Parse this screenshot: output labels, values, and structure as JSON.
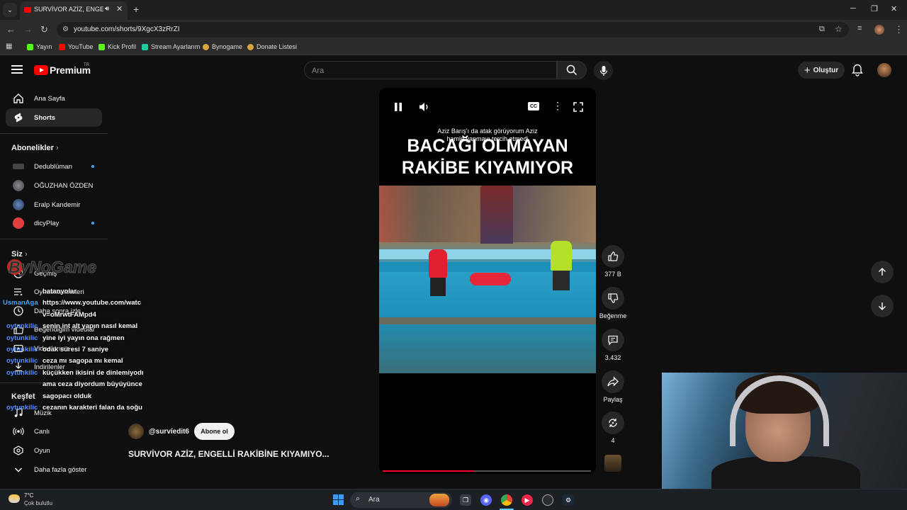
{
  "browser": {
    "tab_title": "SURVİVOR AZİZ, ENGELLİ R",
    "url": "youtube.com/shorts/9XgcX3zRrZI",
    "bookmarks": [
      "Yayın",
      "YouTube",
      "Kick Profil",
      "Stream Ayarlarım",
      "Bynogame",
      "Donate Listesi"
    ]
  },
  "youtube": {
    "brand": "Premium",
    "region": "TR",
    "search_placeholder": "Ara",
    "create_label": "Oluştur"
  },
  "sidebar": {
    "main_items": [
      {
        "label": "Ana Sayfa",
        "icon": "home-icon"
      },
      {
        "label": "Shorts",
        "icon": "shorts-icon",
        "active": true
      }
    ],
    "subscriptions_header": "Abonelikler",
    "subscriptions": [
      {
        "label": "Dedublüman",
        "color": "#444444",
        "new": true
      },
      {
        "label": "OĞUZHAN ÖZDEN",
        "color": "#5a5a66",
        "new": false
      },
      {
        "label": "Eralp Kandemir",
        "color": "#3a5a8a",
        "new": false
      },
      {
        "label": "dicyPlay",
        "color": "#e04040",
        "new": true
      }
    ],
    "you_header": "Siz",
    "you_items": [
      "Geçmiş",
      "Oynatma listeleri",
      "Daha sonra izle",
      "Beğendiğim videolar",
      "Videolarınız",
      "İndirilenler"
    ],
    "explore_header": "Keşfet",
    "explore_items": [
      "Müzik",
      "Canlı",
      "Oyun"
    ],
    "show_more": "Daha fazla göster"
  },
  "chat": {
    "logo": "ByNoGame",
    "messages": [
      {
        "user": "",
        "text": "batanyolar"
      },
      {
        "user": "UsmanAga",
        "text": "https://www.youtube.com/watc"
      },
      {
        "user": "",
        "text": "v=oMrwtFAMpd4"
      },
      {
        "user": "oytunkilic",
        "text": "senin int alt yapın nasıl kemal"
      },
      {
        "user": "oytunkilic",
        "text": "yine iyi yayın ona rağmen"
      },
      {
        "user": "oytunkilic",
        "text": "odak süresi 7 saniye"
      },
      {
        "user": "oytunkilic",
        "text": "ceza mı sagopa mı kemal"
      },
      {
        "user": "oytunkilic",
        "text": "küçükken ikisini de dinlemiyodı"
      },
      {
        "user": "",
        "text": "ama ceza diyordum büyüyünce"
      },
      {
        "user": "",
        "text": "sagopacı olduk"
      },
      {
        "user": "oytunkilic",
        "text": "cezanın karakteri falan da soğu"
      }
    ]
  },
  "short": {
    "caption_line1": "Aziz Barış'ı da atak görüyorum Aziz",
    "caption_line2": "hamle yapmayı tercih etmedi",
    "headline_line1": "BACAĞI OLMAYAN",
    "headline_line2": "RAKİBE KIYAMIYOR",
    "progress": 0.44,
    "channel": "@survíedit6",
    "subscribe_label": "Abone ol",
    "title": "SURVİVOR AZİZ, ENGELLİ RAKİBİNE KIYAMIYO..."
  },
  "actions": {
    "likes": "377 B",
    "dislike_label": "Beğenme",
    "comments": "3.432",
    "share_label": "Paylaş",
    "remix_count": "4"
  },
  "taskbar": {
    "temperature": "7°C",
    "weather": "Çok bulutlu",
    "search": "Ara"
  }
}
